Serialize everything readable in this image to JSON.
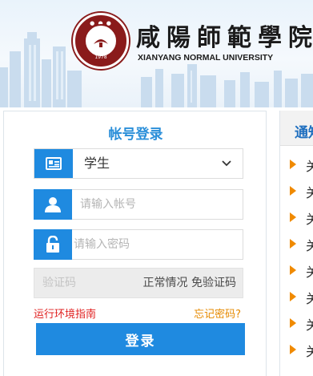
{
  "header": {
    "school_name_cn": "咸陽師範學院",
    "school_name_en": "XIANYANG NORMAL UNIVERSITY",
    "seal_year": "1978"
  },
  "login": {
    "title": "帐号登录",
    "role_select": {
      "value": "学生",
      "icon": "id-card-icon"
    },
    "account": {
      "placeholder": "请输入帐号",
      "icon": "user-icon"
    },
    "password": {
      "placeholder": "请输入密码",
      "icon": "lock-icon"
    },
    "captcha": {
      "placeholder": "验证码",
      "status": "正常情况 免验证码"
    },
    "env_guide_link": "运行环境指南",
    "forgot_link": "忘记密码?",
    "submit_label": "登录"
  },
  "notice": {
    "title": "通知",
    "items": [
      "关",
      "关",
      "关",
      "关",
      "关",
      "关",
      "关",
      "关"
    ]
  },
  "colors": {
    "primary": "#1f8ae0",
    "title_blue": "#2b8fd9",
    "link_red": "#e02020",
    "link_orange": "#e68a00",
    "seal_red": "#8a1b1b"
  }
}
